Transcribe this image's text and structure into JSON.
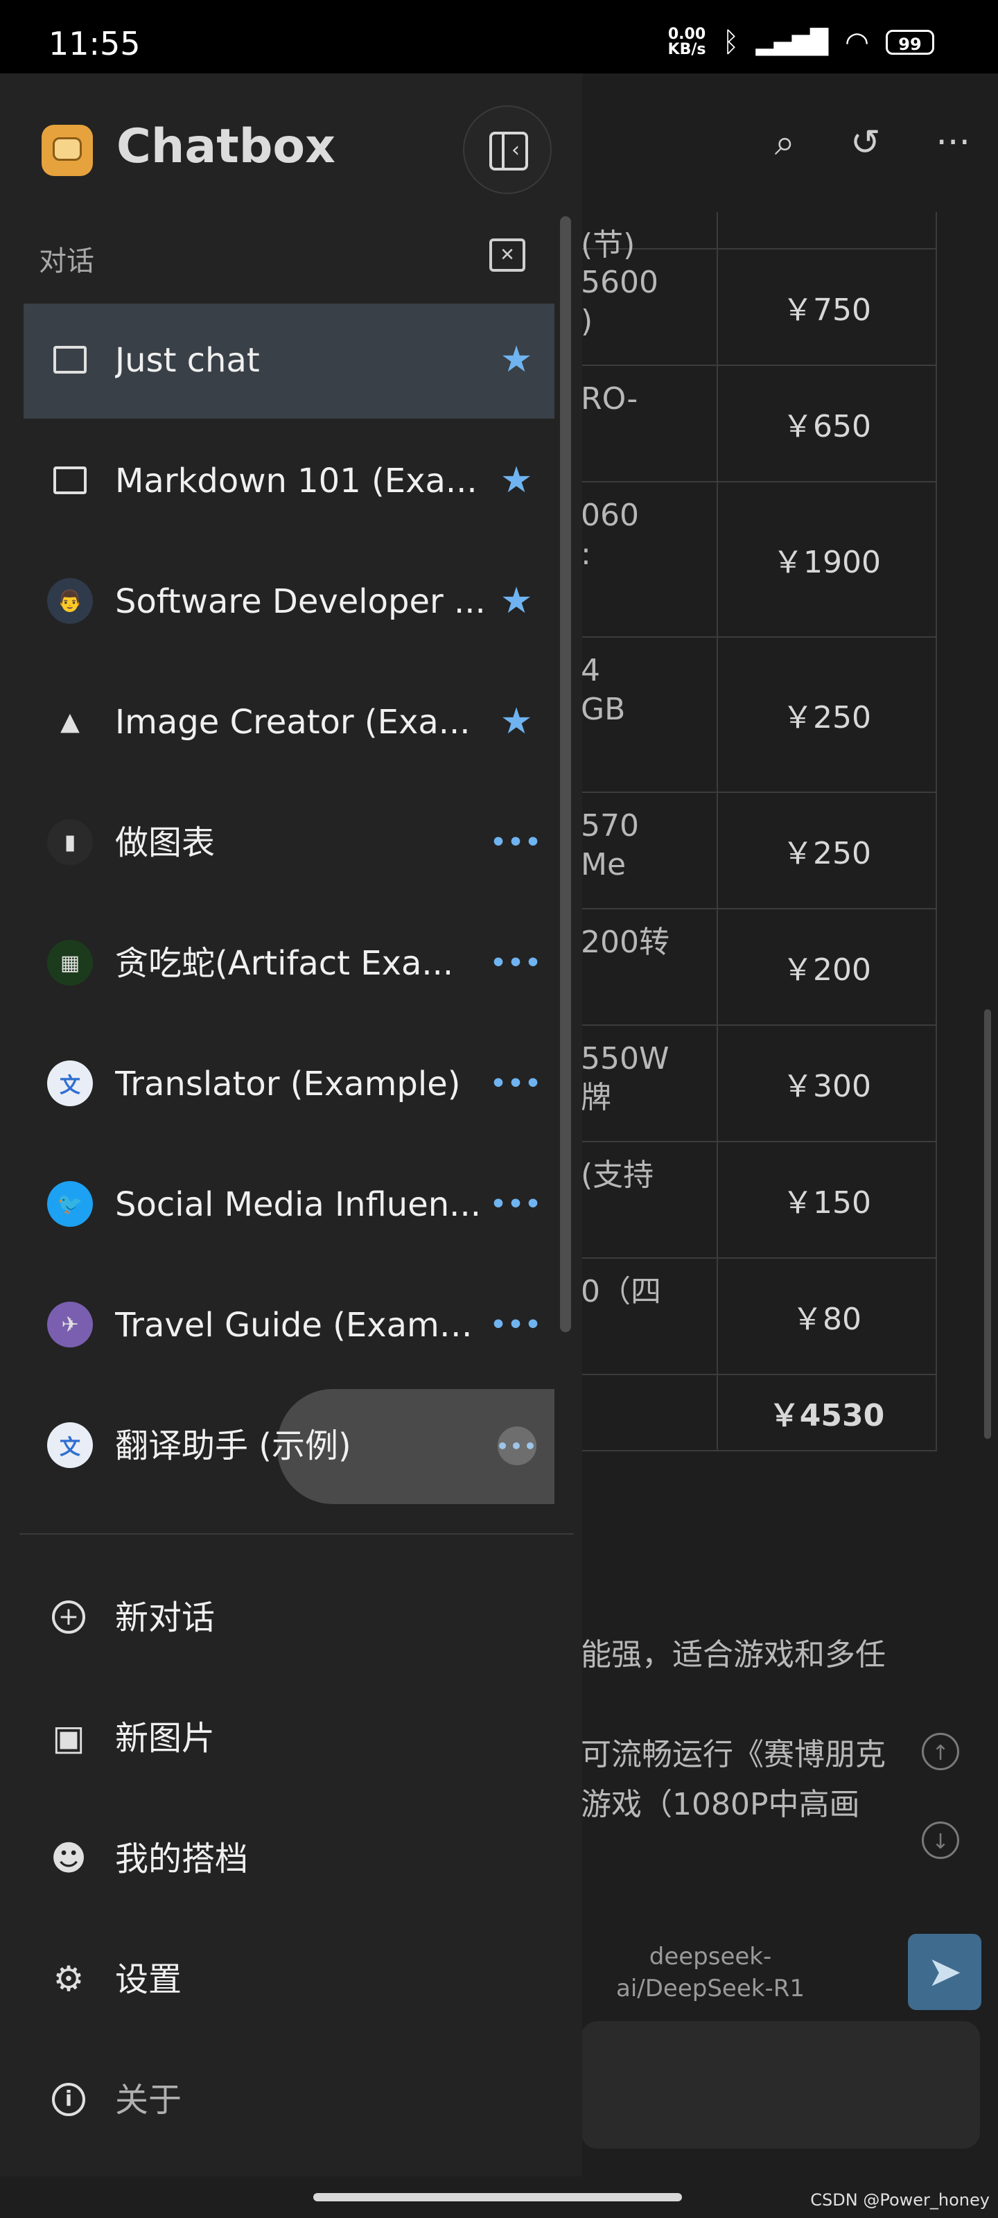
{
  "status_bar": {
    "time": "11:55",
    "net_speed_value": "0.00",
    "net_speed_unit": "KB/s",
    "battery": "99"
  },
  "background_chat": {
    "table_rows": [
      {
        "left": "(节)",
        "right": ""
      },
      {
        "left": "5600\n)",
        "right": "￥750"
      },
      {
        "left": "RO-",
        "right": "￥650"
      },
      {
        "left": "060\n:",
        "right": "￥1900"
      },
      {
        "left": "4\nGB",
        "right": "￥250"
      },
      {
        "left": "570\nMe",
        "right": "￥250"
      },
      {
        "left": "200转",
        "right": "￥200"
      },
      {
        "left": "550W\n牌",
        "right": "￥300"
      },
      {
        "left": "(支持",
        "right": "￥150"
      },
      {
        "left": "0（四",
        "right": "￥80"
      },
      {
        "left": "",
        "right": "￥4530"
      }
    ],
    "text_line_1": "能强，适合游戏和多任",
    "text_line_2": "可流畅运行《赛博朋克",
    "text_line_3": "游戏（1080P中高画",
    "model_line_1": "deepseek-",
    "model_line_2": "ai/DeepSeek-R1"
  },
  "drawer": {
    "app_name": "Chatbox",
    "section_title": "对话",
    "conversations": [
      {
        "title": "Just chat",
        "icon": "message-icon",
        "action": "star"
      },
      {
        "title": "Markdown 101 (Exa...",
        "icon": "message-icon",
        "action": "star"
      },
      {
        "title": "Software Developer ...",
        "icon": "developer-avatar-icon",
        "action": "star"
      },
      {
        "title": "Image Creator (Exa...",
        "icon": "image-icon",
        "action": "star"
      },
      {
        "title": "做图表",
        "icon": "chart-avatar-icon",
        "action": "more"
      },
      {
        "title": "贪吃蛇(Artifact Exa...",
        "icon": "snake-game-avatar-icon",
        "action": "more"
      },
      {
        "title": "Translator (Example)",
        "icon": "translator-avatar-icon",
        "action": "more"
      },
      {
        "title": "Social Media Influen...",
        "icon": "twitter-avatar-icon",
        "action": "more"
      },
      {
        "title": "Travel Guide (Examp...",
        "icon": "travel-avatar-icon",
        "action": "more"
      },
      {
        "title": "翻译助手 (示例)",
        "icon": "translator-avatar-icon",
        "action": "more"
      }
    ],
    "menu": [
      {
        "label": "新对话",
        "icon": "add-circle-icon"
      },
      {
        "label": "新图片",
        "icon": "add-photo-icon"
      },
      {
        "label": "我的搭档",
        "icon": "robot-icon"
      },
      {
        "label": "设置",
        "icon": "gear-icon"
      },
      {
        "label": "关于",
        "icon": "info-icon"
      }
    ]
  },
  "colors": {
    "accent_blue": "#6fb4f0",
    "drawer_bg": "#232323",
    "active_row": "#3a4047"
  },
  "watermark": "CSDN @Power_honey"
}
